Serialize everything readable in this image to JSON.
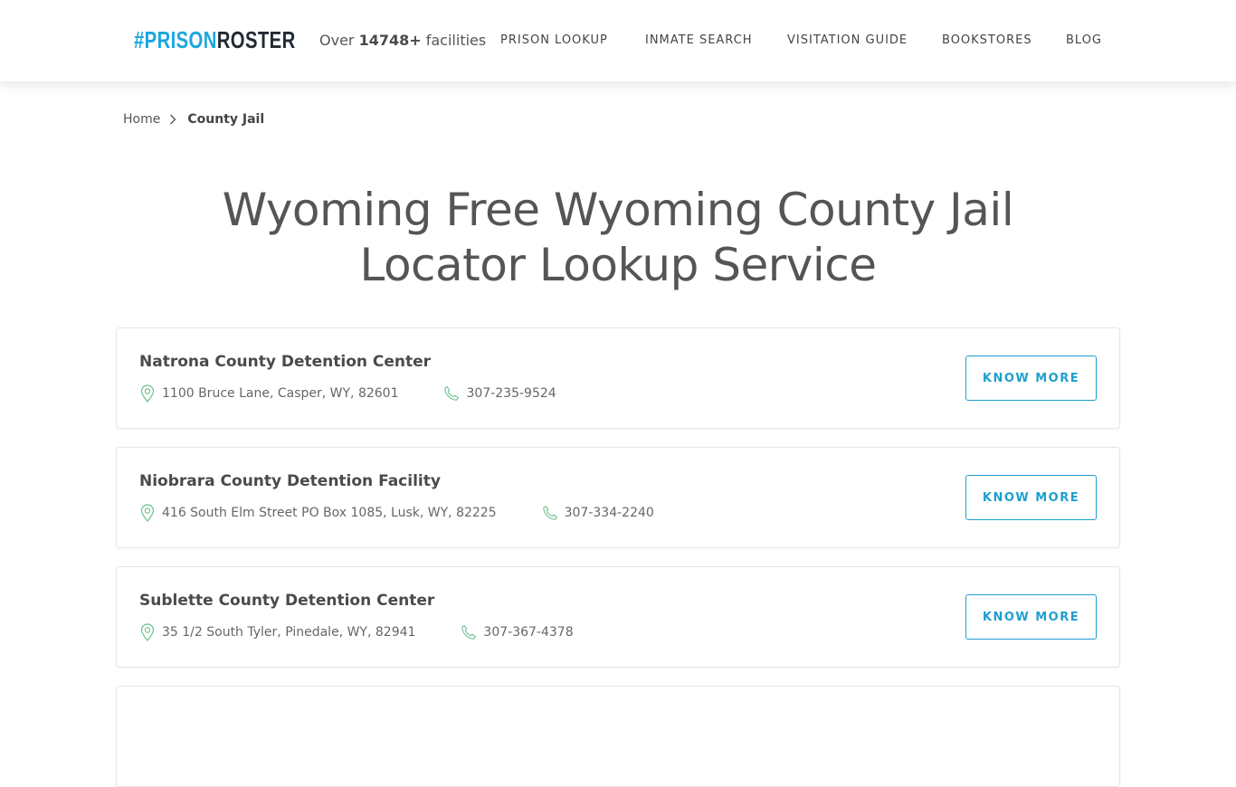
{
  "header": {
    "logo_part1": "#PRISON",
    "logo_part2": "ROSTER",
    "tagline_prefix": "Over ",
    "tagline_count": "14748+",
    "tagline_suffix": " facilities",
    "nav": [
      {
        "label": "PRISON LOOKUP"
      },
      {
        "label": "INMATE SEARCH"
      },
      {
        "label": "VISITATION GUIDE"
      },
      {
        "label": "BOOKSTORES"
      },
      {
        "label": "BLOG"
      }
    ]
  },
  "breadcrumb": {
    "home": "Home",
    "separator_icon": "chevron-right-icon",
    "current": "County Jail"
  },
  "page": {
    "title_line1": "Wyoming Free Wyoming County Jail",
    "title_line2": "Locator Lookup Service"
  },
  "facilities": [
    {
      "name": "Natrona County Detention Center",
      "address": "1100 Bruce Lane, Casper, WY, 82601",
      "phone": "307-235-9524",
      "button": "KNOW MORE"
    },
    {
      "name": "Niobrara County Detention Facility",
      "address": "416 South Elm Street PO Box 1085, Lusk, WY, 82225",
      "phone": "307-334-2240",
      "button": "KNOW MORE"
    },
    {
      "name": "Sublette County Detention Center",
      "address": "35 1/2 South Tyler, Pinedale, WY, 82941",
      "phone": "307-367-4378",
      "button": "KNOW MORE"
    }
  ],
  "icons": {
    "address": "map-pin-icon",
    "phone": "phone-icon"
  },
  "colors": {
    "brand_blue": "#1aa7de",
    "brand_dark": "#222a33",
    "button_accent": "#1e9fcf",
    "icon_green": "#6cc08b",
    "text": "#555555"
  }
}
